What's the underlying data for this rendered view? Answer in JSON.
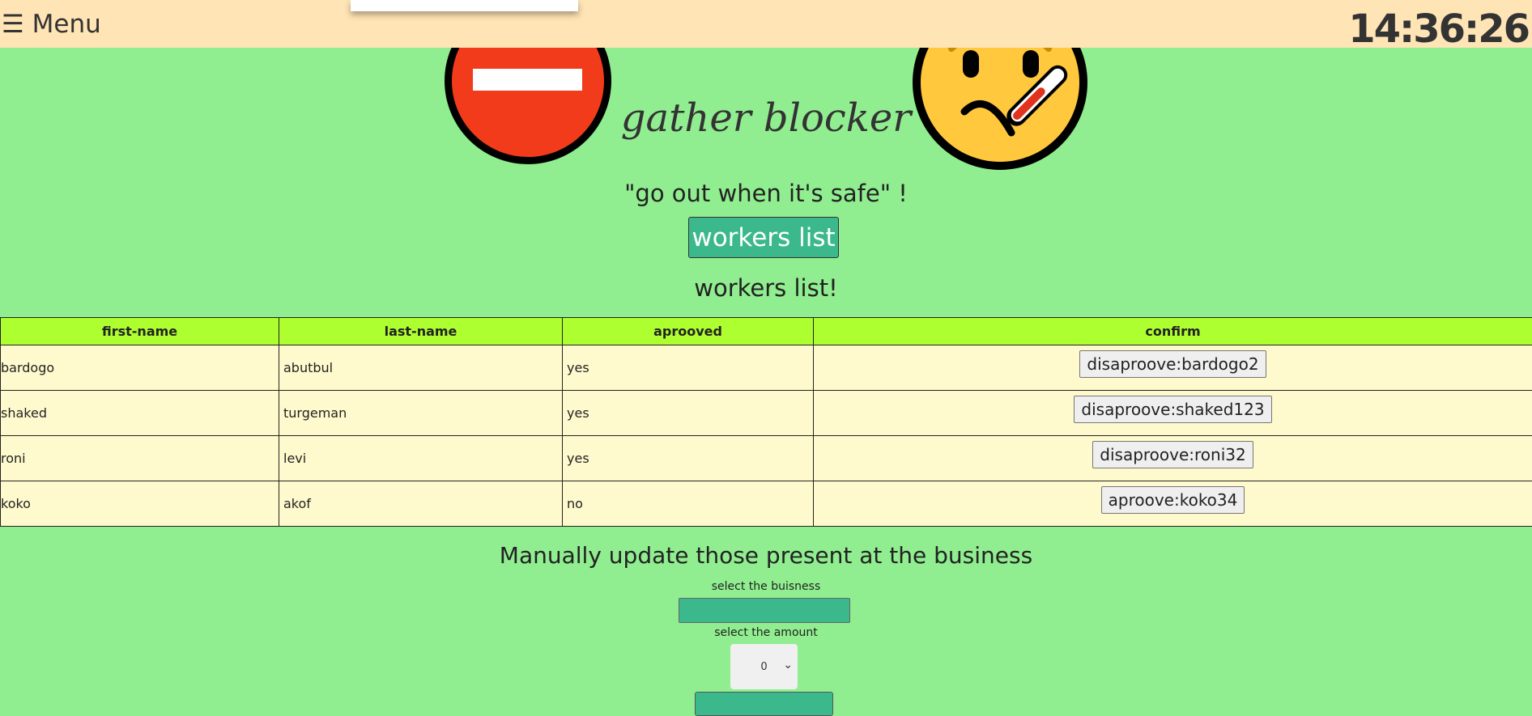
{
  "topbar": {
    "menu_icon": "☰",
    "menu_label": "Menu",
    "clock": "14:36:26"
  },
  "header": {
    "title": "gather blocker",
    "slogan": "\"go out when it's safe\" !",
    "left_emoji_icon": "no-entry-icon",
    "right_emoji_icon": "face-with-thermometer-icon"
  },
  "workers_button_label": "workers list",
  "workers_heading": "workers list!",
  "table": {
    "columns": [
      "first-name",
      "last-name",
      "aprooved",
      "confirm"
    ],
    "rows": [
      {
        "first_name": "bardogo",
        "last_name": "abutbul",
        "approved": "yes",
        "action": "disaproove:bardogo2"
      },
      {
        "first_name": "shaked",
        "last_name": "turgeman",
        "approved": "yes",
        "action": "disaproove:shaked123"
      },
      {
        "first_name": "roni",
        "last_name": "levi",
        "approved": "yes",
        "action": "disaproove:roni32"
      },
      {
        "first_name": "koko",
        "last_name": "akof",
        "approved": "no",
        "action": "aproove:koko34"
      }
    ]
  },
  "manual_update": {
    "heading": "Manually update those present at the business",
    "business_label": "select the buisness",
    "amount_label": "select the amount",
    "amount_value": "0"
  },
  "colors": {
    "background": "#90ee90",
    "topbar": "#ffe4b5",
    "button": "#3cb98c",
    "table_header": "#adff2f",
    "table_row": "#fffacd"
  }
}
